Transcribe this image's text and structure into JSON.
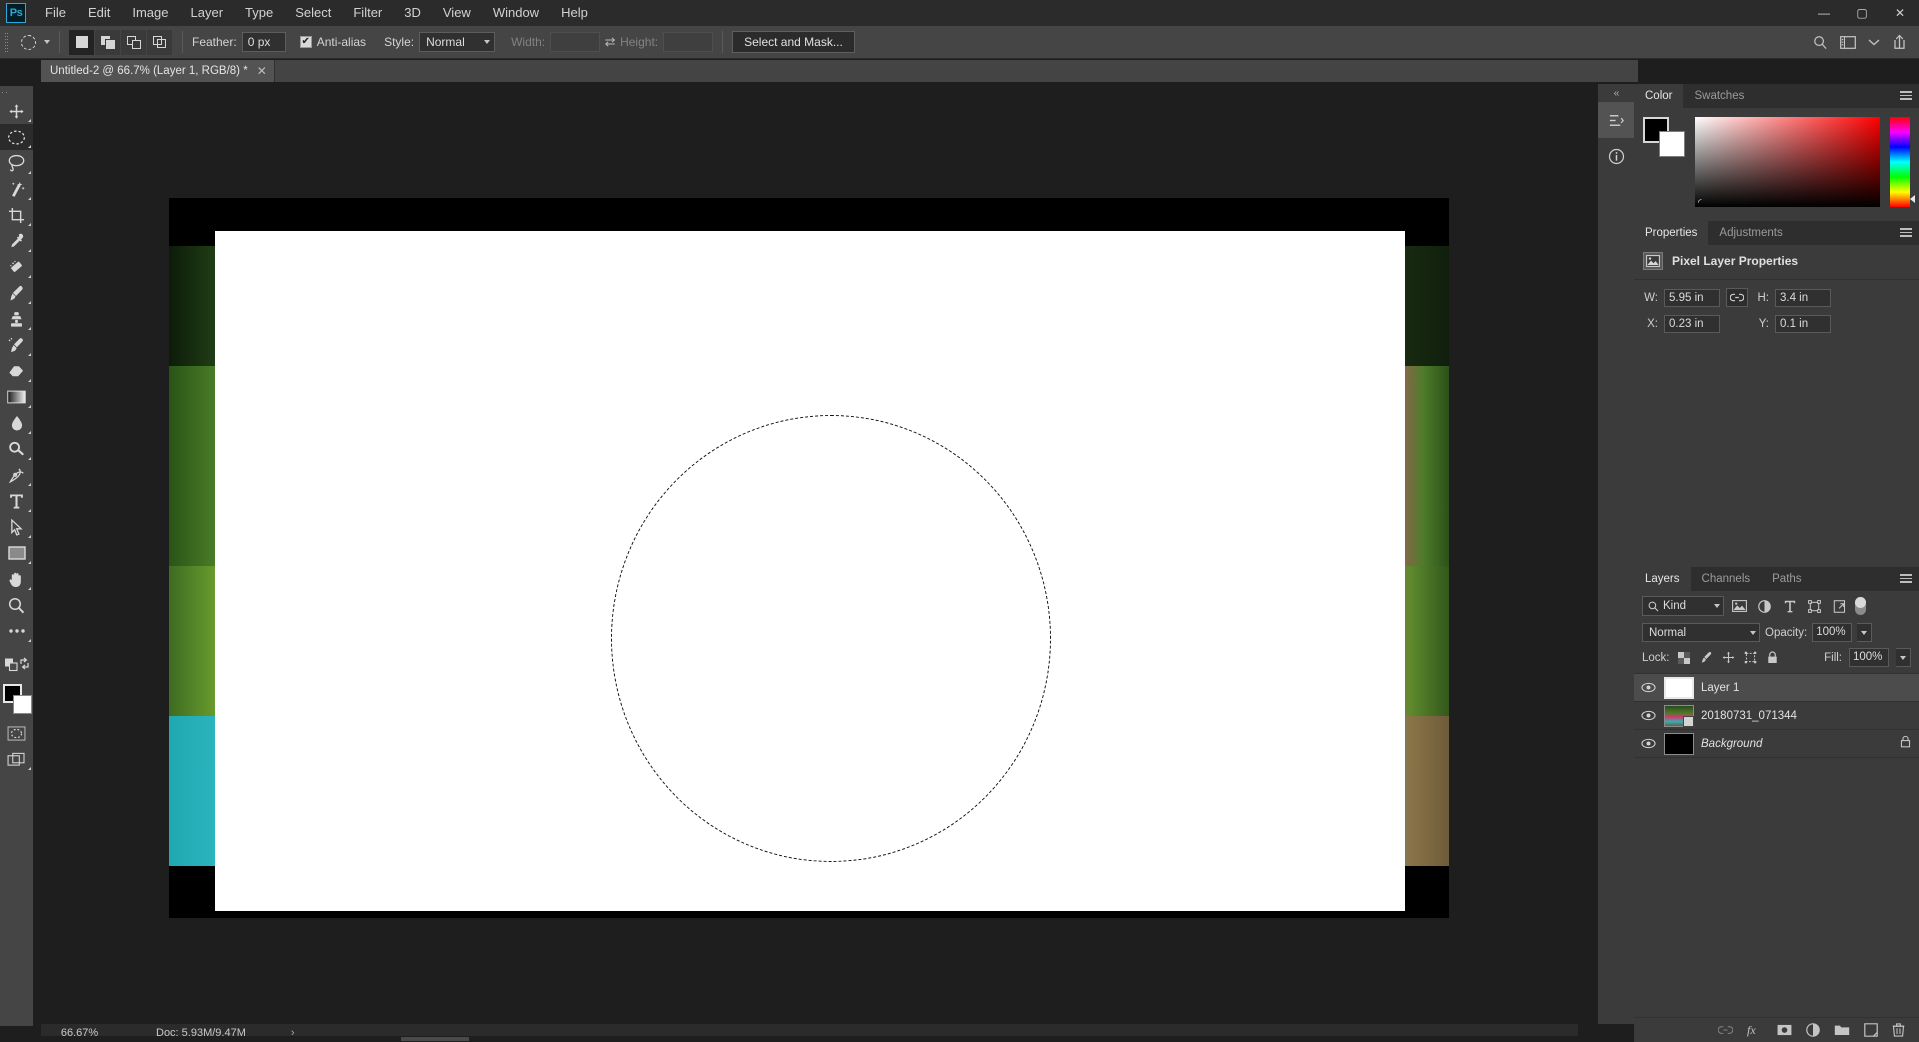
{
  "app": {
    "logo": "Ps"
  },
  "menubar": {
    "items": [
      "File",
      "Edit",
      "Image",
      "Layer",
      "Type",
      "Select",
      "Filter",
      "3D",
      "View",
      "Window",
      "Help"
    ]
  },
  "window_controls": {
    "minimize": "—",
    "maximize": "▢",
    "close": "✕"
  },
  "options_bar": {
    "tool_icon": "ellipse-marquee-icon",
    "selection_modes": [
      "new-selection",
      "add-to-selection",
      "subtract-from-selection",
      "intersect-with-selection"
    ],
    "active_selection_mode": "new-selection",
    "feather_label": "Feather:",
    "feather_value": "0 px",
    "antialias_label": "Anti-alias",
    "antialias_checked": true,
    "style_label": "Style:",
    "style_value": "Normal",
    "width_label": "Width:",
    "width_value": "",
    "height_label": "Height:",
    "height_value": "",
    "swap_icon": "swap-dimensions-icon",
    "select_and_mask": "Select and Mask...",
    "right_icons": [
      "search-icon",
      "workspace-icon",
      "chevron-down-icon",
      "share-icon"
    ]
  },
  "document_tab": {
    "title": "Untitled-2 @ 66.7% (Layer 1, RGB/8) *",
    "close": "✕"
  },
  "toolbar": {
    "tools": [
      {
        "name": "move-tool",
        "glyph": "move"
      },
      {
        "name": "elliptical-marquee-tool",
        "glyph": "marquee",
        "active": true
      },
      {
        "name": "lasso-tool",
        "glyph": "lasso"
      },
      {
        "name": "magic-wand-tool",
        "glyph": "wand"
      },
      {
        "name": "crop-tool",
        "glyph": "crop"
      },
      {
        "name": "eyedropper-tool",
        "glyph": "eyedropper"
      },
      {
        "name": "spot-healing-brush-tool",
        "glyph": "healing"
      },
      {
        "name": "brush-tool",
        "glyph": "brush"
      },
      {
        "name": "clone-stamp-tool",
        "glyph": "stamp"
      },
      {
        "name": "history-brush-tool",
        "glyph": "historybrush"
      },
      {
        "name": "eraser-tool",
        "glyph": "eraser"
      },
      {
        "name": "gradient-tool",
        "glyph": "gradient"
      },
      {
        "name": "blur-tool",
        "glyph": "blur"
      },
      {
        "name": "dodge-tool",
        "glyph": "dodge"
      },
      {
        "name": "pen-tool",
        "glyph": "pen"
      },
      {
        "name": "type-tool",
        "glyph": "type"
      },
      {
        "name": "path-selection-tool",
        "glyph": "pathselect"
      },
      {
        "name": "rectangle-tool",
        "glyph": "rectangle"
      },
      {
        "name": "hand-tool",
        "glyph": "hand"
      },
      {
        "name": "zoom-tool",
        "glyph": "zoom"
      },
      {
        "name": "edit-toolbar-button",
        "glyph": "ellipsis"
      }
    ],
    "default_colors_icon": "default-colors-icon",
    "swap_colors_icon": "swap-colors-icon",
    "foreground_color": "#000000",
    "background_color": "#ffffff",
    "quick_mask_icon": "quick-mask-icon",
    "screen_mode_icon": "screen-mode-icon"
  },
  "canvas": {
    "zoom": "66.7%",
    "selection": {
      "type": "ellipse",
      "marching_ants": true
    }
  },
  "status_bar": {
    "zoom": "66.67%",
    "doc_info": "Doc: 5.93M/9.47M",
    "expand_arrow": "›"
  },
  "icon_rail": {
    "collapse": "‹‹",
    "buttons": [
      "history-panel-icon",
      "info-panel-icon"
    ]
  },
  "color_panel": {
    "tabs": [
      {
        "label": "Color",
        "active": true
      },
      {
        "label": "Swatches",
        "active": false
      }
    ],
    "foreground": "#000000",
    "background": "#ffffff",
    "menu_icon": "panel-menu-icon"
  },
  "properties_panel": {
    "tabs": [
      {
        "label": "Properties",
        "active": true
      },
      {
        "label": "Adjustments",
        "active": false
      }
    ],
    "heading": "Pixel Layer Properties",
    "heading_icon": "pixel-layer-icon",
    "fields": [
      {
        "label": "W:",
        "value": "5.95 in",
        "name": "width-field"
      },
      {
        "label": "H:",
        "value": "3.4 in",
        "name": "height-field"
      },
      {
        "label": "X:",
        "value": "0.23 in",
        "name": "x-position-field"
      },
      {
        "label": "Y:",
        "value": "0.1 in",
        "name": "y-position-field"
      }
    ],
    "link_icon": "link-dimensions-icon",
    "menu_icon": "panel-menu-icon"
  },
  "layers_panel": {
    "tabs": [
      {
        "label": "Layers",
        "active": true
      },
      {
        "label": "Channels",
        "active": false
      },
      {
        "label": "Paths",
        "active": false
      }
    ],
    "filter_label": "Kind",
    "filter_icon": "search-icon",
    "filter_types": [
      "pixel-filter-icon",
      "adjustment-filter-icon",
      "type-filter-icon",
      "shape-filter-icon",
      "smart-object-filter-icon"
    ],
    "filter_toggle": "filter-enable-toggle",
    "blend_mode": "Normal",
    "opacity_label": "Opacity:",
    "opacity_value": "100%",
    "lock_label": "Lock:",
    "lock_icons": [
      "lock-transparency-icon",
      "lock-image-icon",
      "lock-position-icon",
      "lock-artboard-icon",
      "lock-all-icon"
    ],
    "fill_label": "Fill:",
    "fill_value": "100%",
    "layers": [
      {
        "name": "Layer 1",
        "visible": true,
        "selected": true,
        "thumb": "white",
        "locked": false,
        "italic": false
      },
      {
        "name": "20180731_071344",
        "visible": true,
        "selected": false,
        "thumb": "photo",
        "locked": false,
        "italic": false,
        "smart_object": true
      },
      {
        "name": "Background",
        "visible": true,
        "selected": false,
        "thumb": "black",
        "locked": true,
        "italic": true
      }
    ],
    "footer_icons": [
      "link-layers-icon",
      "layer-style-icon",
      "layer-mask-icon",
      "adjustment-layer-icon",
      "new-group-icon",
      "new-layer-icon",
      "delete-layer-icon"
    ],
    "menu_icon": "panel-menu-icon"
  }
}
